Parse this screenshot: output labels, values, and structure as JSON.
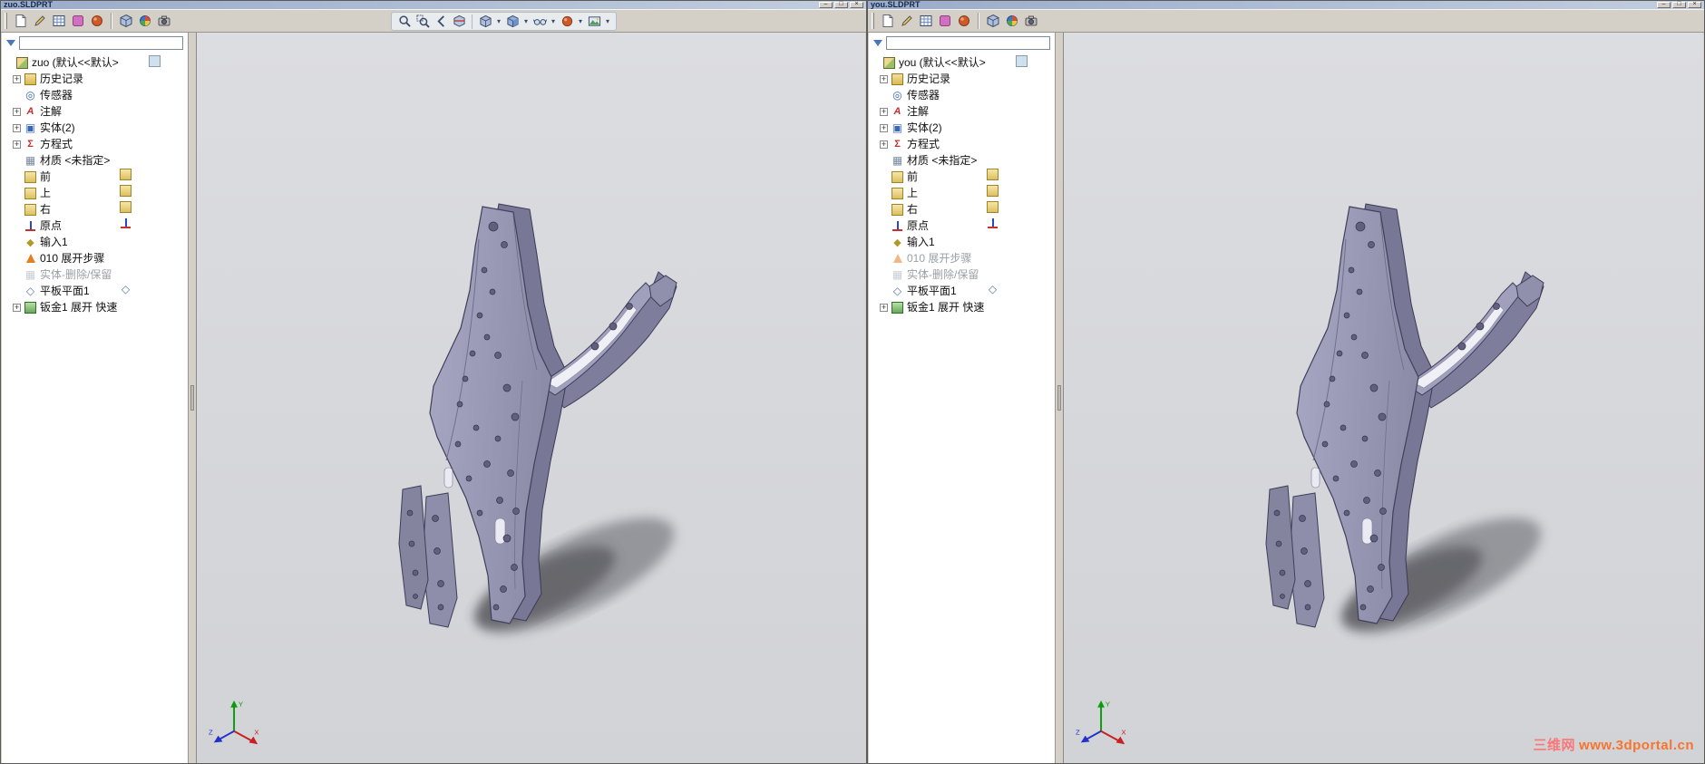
{
  "watermark": {
    "site": "三维网",
    "url": "www.3dportal.cn"
  },
  "triad": {
    "x": "X",
    "y": "Y",
    "z": "Z"
  },
  "icons": {
    "filter-funnel-icon": "funnel",
    "zoom-fit-icon": "magnifier",
    "zoom-area-icon": "magnifier-box",
    "previous-view-icon": "back-arrow",
    "section-view-icon": "sectioned-cube",
    "view-orientation-icon": "cube",
    "display-style-icon": "shaded-cube",
    "hide-show-items-icon": "glasses",
    "edit-appearance-icon": "color-ball",
    "apply-scene-icon": "scene-photo",
    "dropdown-caret": "▾",
    "plane-icon": "gold-square",
    "origin-icon": "xy-axes",
    "expand-toggle": "+"
  },
  "windows": [
    {
      "title": "zuo.SLDPRT",
      "filter_value": "",
      "tree": {
        "root_label": "zuo (默认<<默认>",
        "items": [
          {
            "label": "历史记录",
            "icon": "history",
            "expand": true
          },
          {
            "label": "传感器",
            "icon": "sensors"
          },
          {
            "label": "注解",
            "icon": "annotations",
            "expand": true
          },
          {
            "label": "实体(2)",
            "icon": "bodies",
            "expand": true
          },
          {
            "label": "方程式",
            "icon": "equations",
            "expand": true
          },
          {
            "label": "材质 <未指定>",
            "icon": "material"
          },
          {
            "label": "前",
            "icon": "plane"
          },
          {
            "label": "上",
            "icon": "plane"
          },
          {
            "label": "右",
            "icon": "plane"
          },
          {
            "label": "原点",
            "icon": "origin"
          },
          {
            "label": "输入1",
            "icon": "imported"
          },
          {
            "label": "010 展开步骤",
            "icon": "cone"
          },
          {
            "label": "实体-删除/保留",
            "icon": "body-op",
            "muted": true
          },
          {
            "label": "平板平面1",
            "icon": "flat-plane"
          },
          {
            "label": "钣金1 展开 快速",
            "icon": "sheet-metal",
            "expand": true
          }
        ]
      }
    },
    {
      "title": "you.SLDPRT",
      "filter_value": "",
      "tree": {
        "root_label": "you (默认<<默认>",
        "items": [
          {
            "label": "历史记录",
            "icon": "history",
            "expand": true
          },
          {
            "label": "传感器",
            "icon": "sensors"
          },
          {
            "label": "注解",
            "icon": "annotations",
            "expand": true
          },
          {
            "label": "实体(2)",
            "icon": "bodies",
            "expand": true
          },
          {
            "label": "方程式",
            "icon": "equations",
            "expand": true
          },
          {
            "label": "材质 <未指定>",
            "icon": "material"
          },
          {
            "label": "前",
            "icon": "plane"
          },
          {
            "label": "上",
            "icon": "plane"
          },
          {
            "label": "右",
            "icon": "plane"
          },
          {
            "label": "原点",
            "icon": "origin"
          },
          {
            "label": "输入1",
            "icon": "imported"
          },
          {
            "label": "010 展开步骤",
            "icon": "cone",
            "muted": true
          },
          {
            "label": "实体-删除/保留",
            "icon": "body-op",
            "muted": true
          },
          {
            "label": "平板平面1",
            "icon": "flat-plane"
          },
          {
            "label": "钣金1 展开 快速",
            "icon": "sheet-metal",
            "expand": true
          }
        ]
      }
    }
  ]
}
